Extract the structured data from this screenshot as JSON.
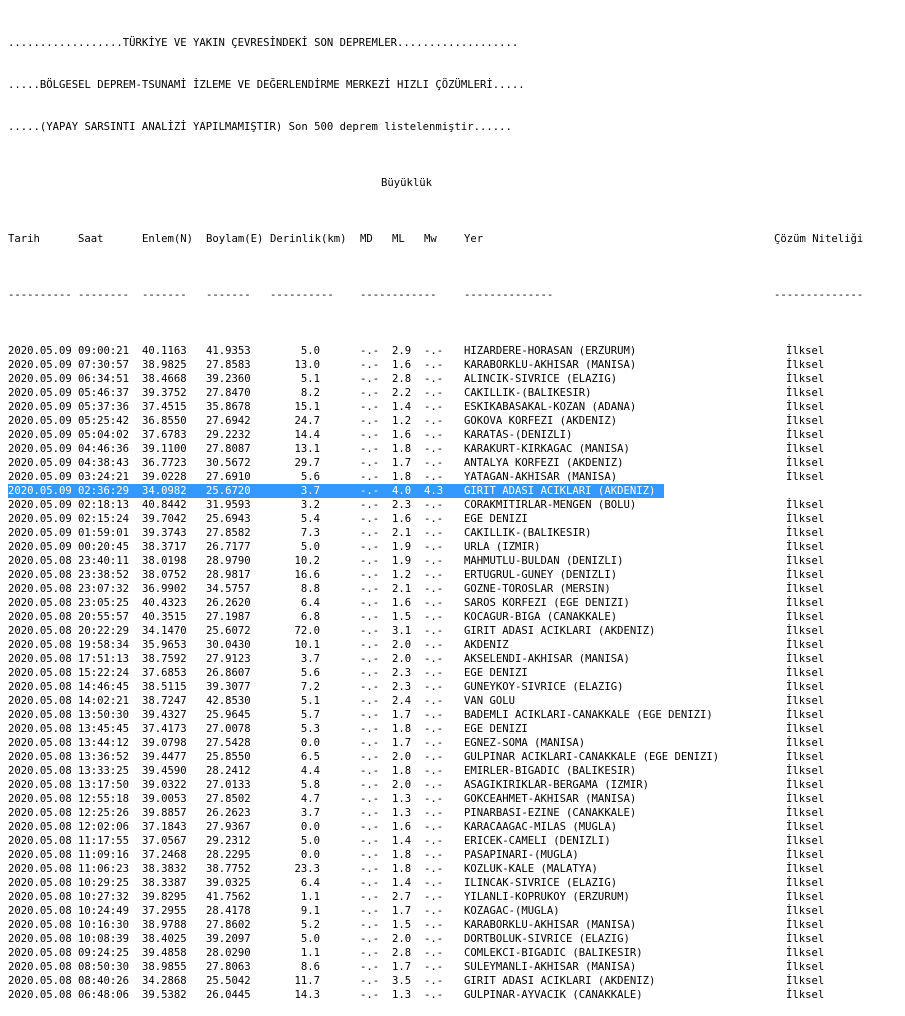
{
  "header": {
    "line1": "..................TÜRKİYE VE YAKIN ÇEVRESİNDEKİ SON DEPREMLER...................",
    "line2": ".....BÖLGESEL DEPREM-TSUNAMİ İZLEME VE DEĞERLENDİRME MERKEZİ HIZLI ÇÖZÜMLERİ.....",
    "line3": ".....(YAPAY SARSINTI ANALİZİ YAPILMAMIŞTIR) Son 500 deprem listelenmiştir......",
    "magnitude_group": "Büyüklük"
  },
  "columns": {
    "date": "Tarih",
    "time": "Saat",
    "lat": "Enlem(N)",
    "lon": "Boylam(E)",
    "depth": "Derinlik(km)",
    "md": "MD",
    "ml": "ML",
    "mw": "Mw",
    "place": "Yer",
    "quality": "Çözüm Niteliği"
  },
  "dashes": {
    "date": "----------",
    "time": "--------",
    "lat": "-------",
    "lon": "-------",
    "depth": "----------",
    "mag": "------------",
    "place": "--------------",
    "quality": "--------------"
  },
  "selected_row": 10,
  "rows": [
    [
      "2020.05.09",
      "09:00:21",
      "40.1163",
      "41.9353",
      "5.0",
      "-.-",
      "2.9",
      "-.-",
      "HIZARDERE-HORASAN (ERZURUM)",
      "İlksel"
    ],
    [
      "2020.05.09",
      "07:30:57",
      "38.9825",
      "27.8583",
      "13.0",
      "-.-",
      "1.6",
      "-.-",
      "KARABORKLU-AKHISAR (MANISA)",
      "İlksel"
    ],
    [
      "2020.05.09",
      "06:34:51",
      "38.4668",
      "39.2360",
      "5.1",
      "-.-",
      "2.8",
      "-.-",
      "ALINCIK-SIVRICE (ELAZIG)",
      "İlksel"
    ],
    [
      "2020.05.09",
      "05:46:37",
      "39.3752",
      "27.8470",
      "8.2",
      "-.-",
      "2.2",
      "-.-",
      "CAKILLIK-(BALIKESIR)",
      "İlksel"
    ],
    [
      "2020.05.09",
      "05:37:36",
      "37.4515",
      "35.8678",
      "15.1",
      "-.-",
      "1.4",
      "-.-",
      "ESKIKABASAKAL-KOZAN (ADANA)",
      "İlksel"
    ],
    [
      "2020.05.09",
      "05:25:42",
      "36.8550",
      "27.6942",
      "24.7",
      "-.-",
      "1.2",
      "-.-",
      "GOKOVA KORFEZI (AKDENIZ)",
      "İlksel"
    ],
    [
      "2020.05.09",
      "05:04:02",
      "37.6783",
      "29.2232",
      "14.4",
      "-.-",
      "1.6",
      "-.-",
      "KARATAS-(DENIZLI)",
      "İlksel"
    ],
    [
      "2020.05.09",
      "04:46:36",
      "39.1100",
      "27.8087",
      "13.1",
      "-.-",
      "1.8",
      "-.-",
      "KARAKURT-KIRKAGAC (MANISA)",
      "İlksel"
    ],
    [
      "2020.05.09",
      "04:38:43",
      "36.7723",
      "30.5672",
      "29.7",
      "-.-",
      "1.7",
      "-.-",
      "ANTALYA KORFEZI (AKDENIZ)",
      "İlksel"
    ],
    [
      "2020.05.09",
      "03:24:21",
      "39.0228",
      "27.6910",
      "5.6",
      "-.-",
      "1.8",
      "-.-",
      "YATAGAN-AKHISAR (MANISA)",
      "İlksel"
    ],
    [
      "2020.05.09",
      "02:36:29",
      "34.0982",
      "25.6720",
      "3.7",
      "-.-",
      "4.0",
      "4.3",
      "GIRIT ADASI ACIKLARI (AKDENIZ)",
      "İlksel"
    ],
    [
      "2020.05.09",
      "02:18:13",
      "40.8442",
      "31.9593",
      "3.2",
      "-.-",
      "2.3",
      "-.-",
      "CORAKMITIRLAR-MENGEN (BOLU)",
      "İlksel"
    ],
    [
      "2020.05.09",
      "02:15:24",
      "39.7042",
      "25.6943",
      "5.4",
      "-.-",
      "1.6",
      "-.-",
      "EGE DENIZI",
      "İlksel"
    ],
    [
      "2020.05.09",
      "01:59:01",
      "39.3743",
      "27.8582",
      "7.3",
      "-.-",
      "2.1",
      "-.-",
      "CAKILLIK-(BALIKESIR)",
      "İlksel"
    ],
    [
      "2020.05.09",
      "00:20:45",
      "38.3717",
      "26.7177",
      "5.0",
      "-.-",
      "1.9",
      "-.-",
      "URLA (IZMIR)",
      "İlksel"
    ],
    [
      "2020.05.08",
      "23:40:11",
      "38.0198",
      "28.9790",
      "10.2",
      "-.-",
      "1.9",
      "-.-",
      "MAHMUTLU-BULDAN (DENIZLI)",
      "İlksel"
    ],
    [
      "2020.05.08",
      "23:38:52",
      "38.0752",
      "28.9817",
      "16.6",
      "-.-",
      "1.2",
      "-.-",
      "ERTUGRUL-GUNEY (DENIZLI)",
      "İlksel"
    ],
    [
      "2020.05.08",
      "23:07:32",
      "36.9902",
      "34.5757",
      "8.8",
      "-.-",
      "2.1",
      "-.-",
      "GOZNE-TOROSLAR (MERSIN)",
      "İlksel"
    ],
    [
      "2020.05.08",
      "23:05:25",
      "40.4323",
      "26.2620",
      "6.4",
      "-.-",
      "1.6",
      "-.-",
      "SAROS KORFEZI (EGE DENIZI)",
      "İlksel"
    ],
    [
      "2020.05.08",
      "20:55:57",
      "40.3515",
      "27.1987",
      "6.8",
      "-.-",
      "1.5",
      "-.-",
      "KOCAGUR-BIGA (CANAKKALE)",
      "İlksel"
    ],
    [
      "2020.05.08",
      "20:22:29",
      "34.1470",
      "25.6072",
      "72.0",
      "-.-",
      "3.1",
      "-.-",
      "GIRIT ADASI ACIKLARI (AKDENIZ)",
      "İlksel"
    ],
    [
      "2020.05.08",
      "19:58:34",
      "35.9653",
      "30.0430",
      "10.1",
      "-.-",
      "2.0",
      "-.-",
      "AKDENIZ",
      "İlksel"
    ],
    [
      "2020.05.08",
      "17:51:13",
      "38.7592",
      "27.9123",
      "3.7",
      "-.-",
      "2.0",
      "-.-",
      "AKSELENDI-AKHISAR (MANISA)",
      "İlksel"
    ],
    [
      "2020.05.08",
      "15:22:24",
      "37.6853",
      "26.8607",
      "5.6",
      "-.-",
      "2.3",
      "-.-",
      "EGE DENIZI",
      "İlksel"
    ],
    [
      "2020.05.08",
      "14:46:45",
      "38.5115",
      "39.3077",
      "7.2",
      "-.-",
      "2.3",
      "-.-",
      "GUNEYKOY-SIVRICE (ELAZIG)",
      "İlksel"
    ],
    [
      "2020.05.08",
      "14:02:21",
      "38.7247",
      "42.8530",
      "5.1",
      "-.-",
      "2.4",
      "-.-",
      "VAN GOLU",
      "İlksel"
    ],
    [
      "2020.05.08",
      "13:50:30",
      "39.4327",
      "25.9645",
      "5.7",
      "-.-",
      "1.7",
      "-.-",
      "BADEMLI ACIKLARI-CANAKKALE (EGE DENIZI)",
      "İlksel"
    ],
    [
      "2020.05.08",
      "13:45:45",
      "37.4173",
      "27.0078",
      "5.3",
      "-.-",
      "1.8",
      "-.-",
      "EGE DENIZI",
      "İlksel"
    ],
    [
      "2020.05.08",
      "13:44:12",
      "39.0798",
      "27.5428",
      "0.0",
      "-.-",
      "1.7",
      "-.-",
      "EGNEZ-SOMA (MANISA)",
      "İlksel"
    ],
    [
      "2020.05.08",
      "13:36:52",
      "39.4477",
      "25.8550",
      "6.5",
      "-.-",
      "2.0",
      "-.-",
      "GULPINAR ACIKLARI-CANAKKALE (EGE DENIZI)",
      "İlksel"
    ],
    [
      "2020.05.08",
      "13:33:25",
      "39.4590",
      "28.2412",
      "4.4",
      "-.-",
      "1.8",
      "-.-",
      "EMIRLER-BIGADIC (BALIKESIR)",
      "İlksel"
    ],
    [
      "2020.05.08",
      "13:17:50",
      "39.0322",
      "27.0133",
      "5.8",
      "-.-",
      "2.0",
      "-.-",
      "ASAGIKIRIKLAR-BERGAMA (IZMIR)",
      "İlksel"
    ],
    [
      "2020.05.08",
      "12:55:18",
      "39.0053",
      "27.8502",
      "4.7",
      "-.-",
      "1.3",
      "-.-",
      "GOKCEAHMET-AKHISAR (MANISA)",
      "İlksel"
    ],
    [
      "2020.05.08",
      "12:25:26",
      "39.8857",
      "26.2623",
      "3.7",
      "-.-",
      "1.3",
      "-.-",
      "PINARBASI-EZINE (CANAKKALE)",
      "İlksel"
    ],
    [
      "2020.05.08",
      "12:02:06",
      "37.1843",
      "27.9367",
      "0.0",
      "-.-",
      "1.6",
      "-.-",
      "KARACAAGAC-MILAS (MUGLA)",
      "İlksel"
    ],
    [
      "2020.05.08",
      "11:17:55",
      "37.0567",
      "29.2312",
      "5.0",
      "-.-",
      "1.4",
      "-.-",
      "ERICEK-CAMELI (DENIZLI)",
      "İlksel"
    ],
    [
      "2020.05.08",
      "11:09:16",
      "37.2468",
      "28.2295",
      "0.0",
      "-.-",
      "1.8",
      "-.-",
      "PASAPINARI-(MUGLA)",
      "İlksel"
    ],
    [
      "2020.05.08",
      "11:06:23",
      "38.3832",
      "38.7752",
      "23.3",
      "-.-",
      "1.8",
      "-.-",
      "KOZLUK-KALE (MALATYA)",
      "İlksel"
    ],
    [
      "2020.05.08",
      "10:29:25",
      "38.3387",
      "39.0325",
      "6.4",
      "-.-",
      "1.4",
      "-.-",
      "ILINCAK-SIVRICE (ELAZIG)",
      "İlksel"
    ],
    [
      "2020.05.08",
      "10:27:32",
      "39.8295",
      "41.7562",
      "1.1",
      "-.-",
      "2.7",
      "-.-",
      "YILANLI-KOPRUKOY (ERZURUM)",
      "İlksel"
    ],
    [
      "2020.05.08",
      "10:24:49",
      "37.2955",
      "28.4178",
      "9.1",
      "-.-",
      "1.7",
      "-.-",
      "KOZAGAC-(MUGLA)",
      "İlksel"
    ],
    [
      "2020.05.08",
      "10:16:30",
      "38.9788",
      "27.8602",
      "5.2",
      "-.-",
      "1.5",
      "-.-",
      "KARABORKLU-AKHISAR (MANISA)",
      "İlksel"
    ],
    [
      "2020.05.08",
      "10:08:39",
      "38.4025",
      "39.2097",
      "5.0",
      "-.-",
      "2.0",
      "-.-",
      "DORTBOLUK-SIVRICE (ELAZIG)",
      "İlksel"
    ],
    [
      "2020.05.08",
      "09:24:25",
      "39.4858",
      "28.0290",
      "1.1",
      "-.-",
      "2.8",
      "-.-",
      "COMLEKCI-BIGADIC (BALIKESIR)",
      "İlksel"
    ],
    [
      "2020.05.08",
      "08:50:30",
      "38.9855",
      "27.8063",
      "8.6",
      "-.-",
      "1.7",
      "-.-",
      "SULEYMANLI-AKHISAR (MANISA)",
      "İlksel"
    ],
    [
      "2020.05.08",
      "08:40:26",
      "34.2868",
      "25.5042",
      "11.7",
      "-.-",
      "3.5",
      "-.-",
      "GIRIT ADASI ACIKLARI (AKDENIZ)",
      "İlksel"
    ],
    [
      "2020.05.08",
      "06:48:06",
      "39.5382",
      "26.0445",
      "14.3",
      "-.-",
      "1.3",
      "-.-",
      "GULPINAR-AYVACIK (CANAKKALE)",
      "İlksel"
    ]
  ]
}
